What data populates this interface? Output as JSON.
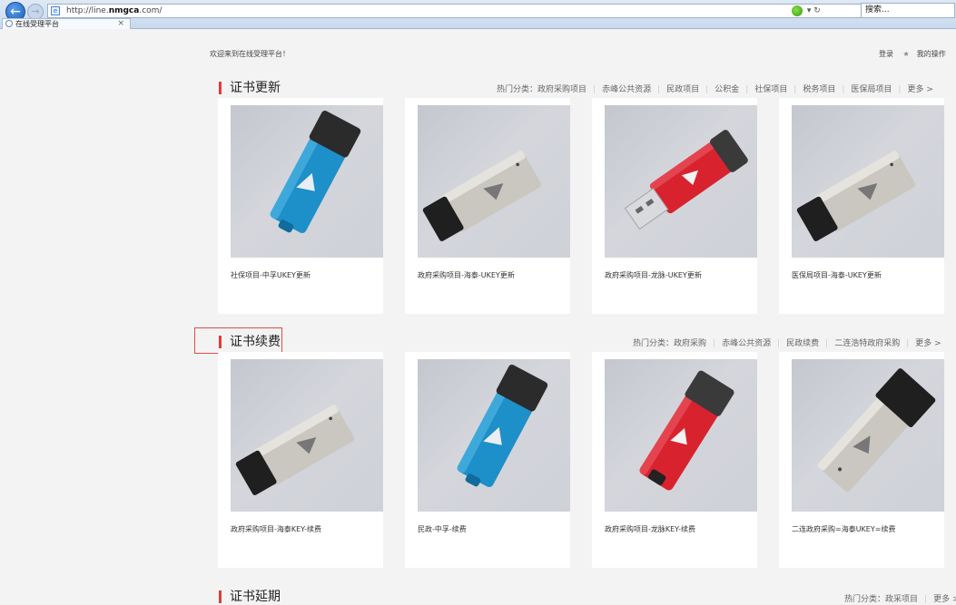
{
  "browser": {
    "url_prefix": "http://line.",
    "url_domain": "nmgca",
    "url_suffix": ".com/",
    "refresh_glyph": "▾ ↻",
    "search_placeholder": "搜索...",
    "tab_title": "在线受理平台",
    "tab_close": "×"
  },
  "header": {
    "welcome": "欢迎来到在线受理平台！",
    "login": "登录",
    "my_ops": "我的操作"
  },
  "sections": [
    {
      "title": "证书更新",
      "hot_label": "热门分类：",
      "hot_items": [
        "政府采购项目",
        "赤峰公共资源",
        "民政项目",
        "公积金",
        "社保项目",
        "税务项目",
        "医保局项目",
        "更多 >"
      ],
      "cards": [
        {
          "caption": "社保项目-中孚UKEY更新",
          "key": "blue-angled"
        },
        {
          "caption": "政府采购项目-海泰-UKEY更新",
          "key": "silver"
        },
        {
          "caption": "政府采购项目-龙脉-UKEY更新",
          "key": "red-open"
        },
        {
          "caption": "医保局项目-海泰-UKEY更新",
          "key": "silver"
        }
      ]
    },
    {
      "title": "证书续费",
      "hot_label": "热门分类：",
      "hot_items": [
        "政府采购",
        "赤峰公共资源",
        "民政续费",
        "二连浩特政府采购",
        "更多 >"
      ],
      "cards": [
        {
          "caption": "政府采购项目-海泰KEY-续费",
          "key": "silver"
        },
        {
          "caption": "民政-中孚-续费",
          "key": "blue-angled"
        },
        {
          "caption": "政府采购项目-龙脉KEY-续费",
          "key": "red-closed"
        },
        {
          "caption": "二连政府采购=海泰UKEY=续费",
          "key": "silver-steep"
        }
      ]
    },
    {
      "title": "证书延期",
      "hot_label": "热门分类：",
      "hot_items": [
        "政采项目",
        "更多 >"
      ],
      "cards": []
    }
  ],
  "colors": {
    "accent_red": "#e23b3b",
    "key_blue": "#1d8fc9",
    "key_red": "#d8232f",
    "key_silver": "#c9c7c0"
  }
}
